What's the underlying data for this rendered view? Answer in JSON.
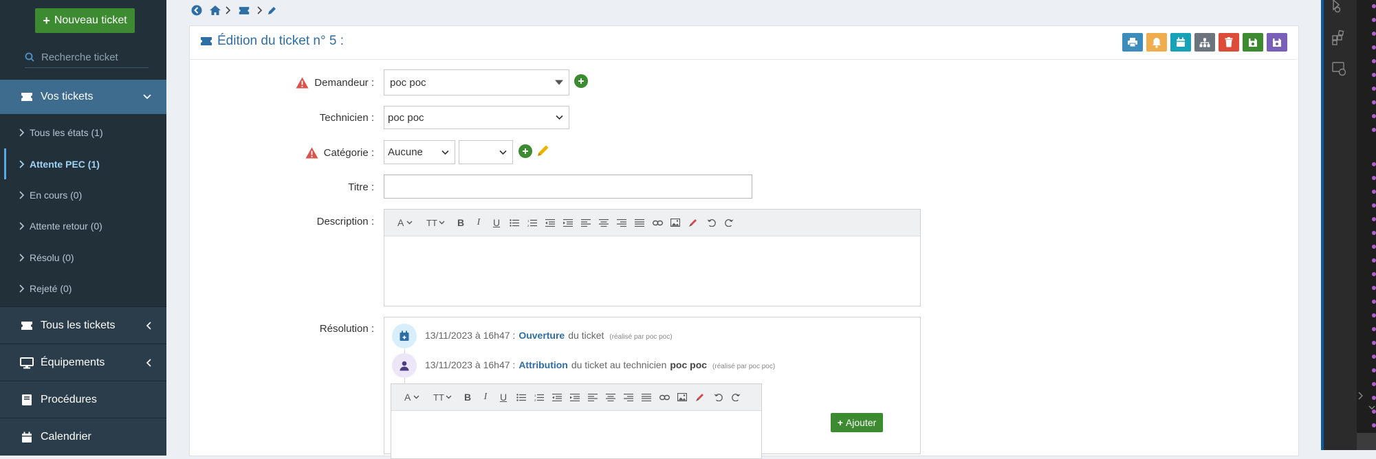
{
  "sidebar": {
    "new_ticket": "Nouveau ticket",
    "search_placeholder": "Recherche ticket",
    "vos_tickets": "Vos tickets",
    "sub_items": [
      {
        "label": "Tous les états (1)"
      },
      {
        "label": "Attente PEC (1)"
      },
      {
        "label": "En cours (0)"
      },
      {
        "label": "Attente retour (0)"
      },
      {
        "label": "Résolu (0)"
      },
      {
        "label": "Rejeté (0)"
      }
    ],
    "tous_les_tickets": "Tous les tickets",
    "equipements": "Équipements",
    "procedures": "Procédures",
    "calendrier": "Calendrier"
  },
  "card": {
    "title": "Édition du ticket n° 5 :"
  },
  "form": {
    "demandeur_label": "Demandeur :",
    "demandeur_value": "poc poc",
    "technicien_label": "Technicien :",
    "technicien_value": "poc poc",
    "categorie_label": "Catégorie :",
    "categorie_value": "Aucune",
    "subcategorie_value": "",
    "titre_label": "Titre :",
    "titre_value": "",
    "description_label": "Description :",
    "resolution_label": "Résolution :"
  },
  "timeline": [
    {
      "date": "13/11/2023 à 16h47 :",
      "action": "Ouverture",
      "rest": "du ticket",
      "bold": "",
      "by": "(réalisé par poc poc)"
    },
    {
      "date": "13/11/2023 à 16h47 :",
      "action": "Attribution",
      "rest": "du ticket au technicien",
      "bold": "poc poc",
      "by": "(réalisé par poc poc)"
    }
  ],
  "ajouter_label": "Ajouter",
  "colors": {
    "sidebar_bg": "#22303a",
    "active_item": "#3e6c8f",
    "green": "#3c8b30",
    "link_blue": "#2d6ea5",
    "warning_red": "#d9534f"
  },
  "toolbar_buttons": [
    {
      "name": "print-icon",
      "color": "#3c8dbc"
    },
    {
      "name": "bell-icon",
      "color": "#f0ad4e"
    },
    {
      "name": "calendar-icon",
      "color": "#17a2b8"
    },
    {
      "name": "sitemap-icon",
      "color": "#6c757d"
    },
    {
      "name": "trash-icon",
      "color": "#dd4b39"
    },
    {
      "name": "save-icon",
      "color": "#3c8b30"
    },
    {
      "name": "save-close-icon",
      "color": "#7a5fb8"
    }
  ]
}
